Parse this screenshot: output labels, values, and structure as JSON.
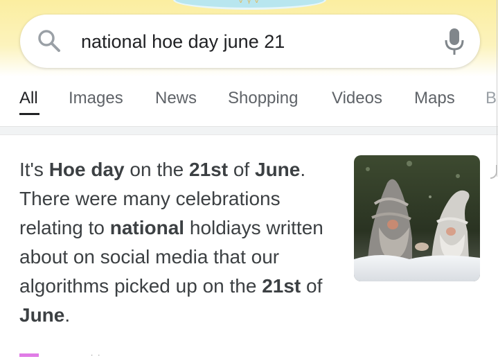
{
  "search": {
    "query": "national hoe day june 21"
  },
  "tabs": [
    {
      "label": "All",
      "active": true
    },
    {
      "label": "Images",
      "active": false
    },
    {
      "label": "News",
      "active": false
    },
    {
      "label": "Shopping",
      "active": false
    },
    {
      "label": "Videos",
      "active": false
    },
    {
      "label": "Maps",
      "active": false
    },
    {
      "label": "B",
      "active": false
    }
  ],
  "answer": {
    "segments": [
      {
        "text": "It's ",
        "bold": false
      },
      {
        "text": "Hoe day",
        "bold": true
      },
      {
        "text": " on the ",
        "bold": false
      },
      {
        "text": "21st",
        "bold": true
      },
      {
        "text": " of ",
        "bold": false
      },
      {
        "text": "June",
        "bold": true
      },
      {
        "text": ". There were many celebrations relating to ",
        "bold": false
      },
      {
        "text": "national",
        "bold": true
      },
      {
        "text": " holdiays written about on social media that our algorithms picked up on the ",
        "bold": false
      },
      {
        "text": "21st",
        "bold": true
      },
      {
        "text": " of ",
        "bold": false
      },
      {
        "text": "June",
        "bold": true
      },
      {
        "text": ".",
        "bold": false
      }
    ]
  },
  "thumbnail": {
    "icon": "gnomes-in-snow-image"
  },
  "colors": {
    "accent_text": "#202124",
    "tab_inactive": "#5f6368",
    "header_yellow": "#fbeea0",
    "badge_magenta": "#e07ce6"
  }
}
